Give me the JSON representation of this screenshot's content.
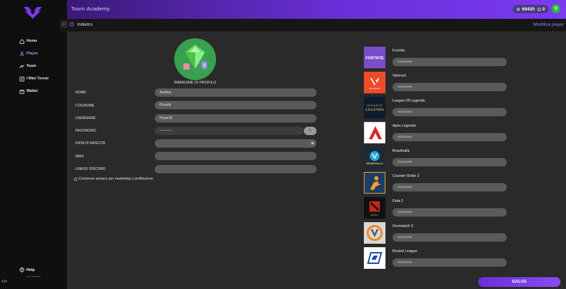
{
  "app": {
    "title": "Tourn Academy",
    "brand_small": "Tourn Academy"
  },
  "topbar": {
    "coins": "69420",
    "tickets": "0"
  },
  "sidebar": {
    "items": [
      {
        "label": "Home",
        "icon": "home-icon",
        "active": false
      },
      {
        "label": "Player",
        "icon": "user-icon",
        "active": true
      },
      {
        "label": "Team",
        "icon": "team-icon",
        "active": false
      },
      {
        "label": "I Miei Tornei",
        "icon": "list-icon",
        "active": false
      },
      {
        "label": "Wallet",
        "icon": "wallet-icon",
        "active": false
      }
    ],
    "help": "Help"
  },
  "subbar": {
    "back": "Indietro",
    "edit": "Modifica player"
  },
  "profile": {
    "label": "IMMAGINE DI PROFILO"
  },
  "form": {
    "nome_label": "NOME",
    "nome_value": "Andrea",
    "cognome_label": "COGNOME",
    "cognome_value": "Pizzetti",
    "username_label": "USERNAME",
    "username_value": "Pizzo78",
    "password_label": "PASSWORD",
    "password_value": "••••••••••",
    "nascita_label": "DATA DI NASCITA",
    "nascita_value": "",
    "iban_label": "IBAN",
    "iban_value": "",
    "discord_label": "LINK/ID DISCORD",
    "discord_value": "",
    "privacy_label": "Consenso privacy per marketing e profilazione"
  },
  "games": [
    {
      "name": "Fortnite",
      "placeholder": "nickname"
    },
    {
      "name": "Valorant",
      "placeholder": "nickname"
    },
    {
      "name": "League Of Legends",
      "placeholder": "nickname"
    },
    {
      "name": "Apex Legends",
      "placeholder": "nickname"
    },
    {
      "name": "Brawlhalla",
      "placeholder": "nickname"
    },
    {
      "name": "Counter-Strike 2",
      "placeholder": "nickname"
    },
    {
      "name": "Dota 2",
      "placeholder": "nickname"
    },
    {
      "name": "Overwatch 2",
      "placeholder": "nickname"
    },
    {
      "name": "Rocket League",
      "placeholder": "nickname"
    }
  ],
  "tiles": {
    "fortnite": "FORTNITE",
    "valorant": "VALORANT",
    "lol_1": "LEAGUE OF",
    "lol_2": "LEGENDS",
    "brawlhalla": "BRAWLHALLA",
    "dota": "DOTA 2"
  },
  "actions": {
    "save": "SALVA"
  }
}
